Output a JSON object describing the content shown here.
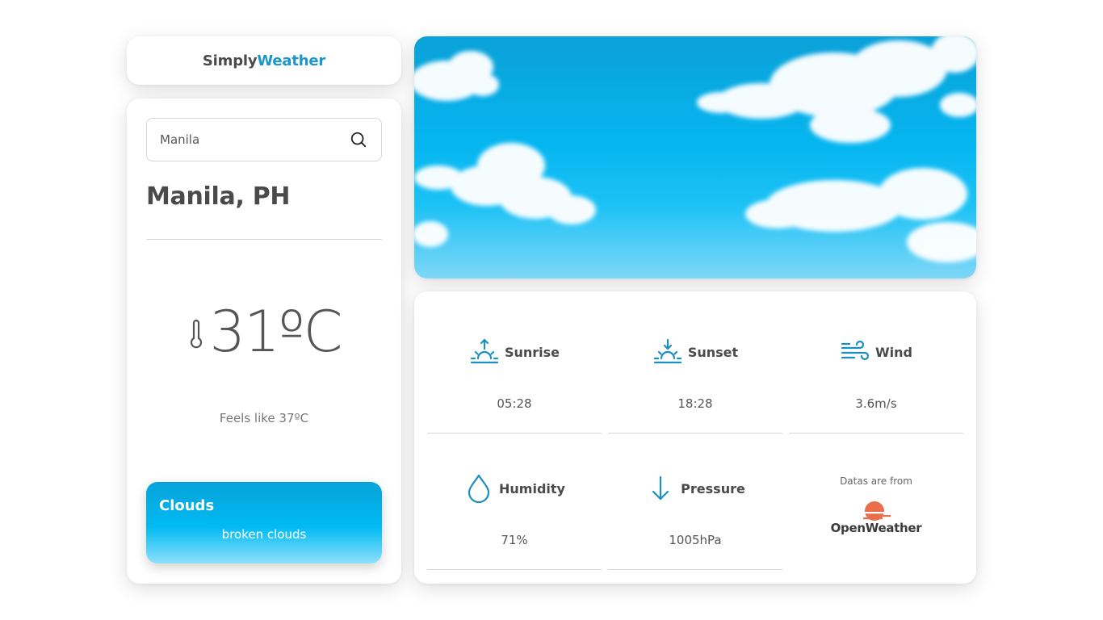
{
  "app": {
    "logo_part1": "Simply",
    "logo_part2": "Weather",
    "brand_color": "#1b96c9"
  },
  "search": {
    "value": "Manila",
    "icon": "search-icon"
  },
  "location": {
    "city": "Manila, PH"
  },
  "current": {
    "temperature": "31ºC",
    "feels_like": "Feels like 37ºC",
    "icon": "thermometer-icon"
  },
  "condition": {
    "title": "Clouds",
    "description": "broken clouds"
  },
  "details": [
    {
      "label": "Sunrise",
      "value": "05:28",
      "icon": "sunrise-icon"
    },
    {
      "label": "Sunset",
      "value": "18:28",
      "icon": "sunset-icon"
    },
    {
      "label": "Wind",
      "value": "3.6m/s",
      "icon": "wind-icon"
    },
    {
      "label": "Humidity",
      "value": "71%",
      "icon": "humidity-drop-icon"
    },
    {
      "label": "Pressure",
      "value": "1005hPa",
      "icon": "pressure-arrow-icon"
    }
  ],
  "credit": {
    "text": "Datas are from",
    "provider": "OpenWeather",
    "provider_color": "#eb6e4b"
  },
  "colors": {
    "accent": "#1b96c9",
    "icon_blue": "#1b8fc4",
    "text_dark": "#4a4a4a"
  }
}
